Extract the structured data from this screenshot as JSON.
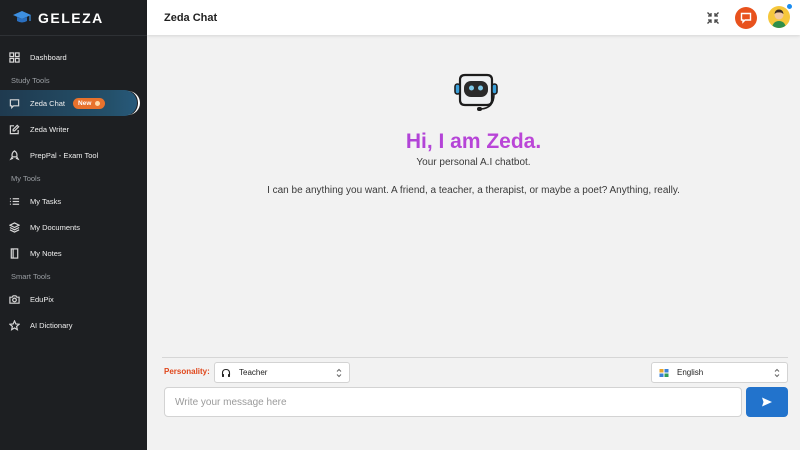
{
  "brand": {
    "name": "GELEZA"
  },
  "sidebar": {
    "items": [
      {
        "label": "Dashboard",
        "icon": "dashboard-grid-icon"
      },
      {
        "label": "Zeda Chat",
        "icon": "chat-icon",
        "active": true,
        "badge": "New"
      },
      {
        "label": "Zeda Writer",
        "icon": "pencil-square-icon"
      },
      {
        "label": "PrepPal - Exam Tool",
        "icon": "rocket-icon"
      },
      {
        "label": "My Tasks",
        "icon": "list-icon"
      },
      {
        "label": "My Documents",
        "icon": "layers-icon"
      },
      {
        "label": "My Notes",
        "icon": "notebook-icon"
      },
      {
        "label": "EduPix",
        "icon": "camera-icon"
      },
      {
        "label": "AI Dictionary",
        "icon": "star-icon"
      }
    ],
    "sections": [
      "Study Tools",
      "My Tools",
      "Smart Tools"
    ]
  },
  "header": {
    "title": "Zeda Chat"
  },
  "main": {
    "greeting": "Hi, I am Zeda.",
    "subtitle": "Your personal A.I chatbot.",
    "intro": "I can be anything you want. A friend, a teacher, a therapist, or maybe a poet? Anything, really."
  },
  "controls": {
    "personality_label": "Personality:",
    "personality_value": "Teacher",
    "language_value": "English",
    "message_placeholder": "Write your message here"
  },
  "colors": {
    "sidebar_bg": "#1d1f22",
    "accent_orange": "#e8521d",
    "send_blue": "#2273cc",
    "greeting_purple": "#b44ce0"
  }
}
